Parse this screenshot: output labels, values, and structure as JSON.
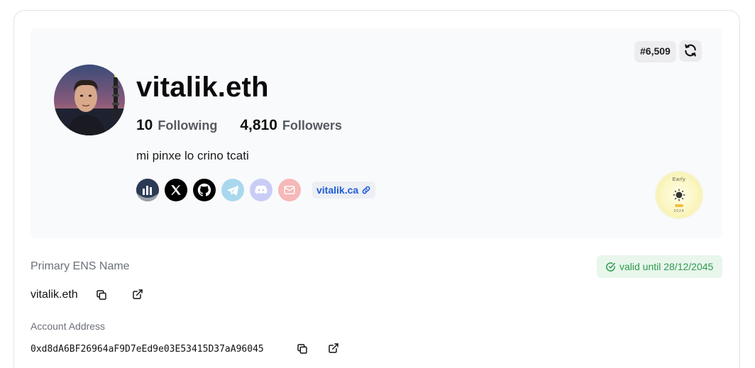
{
  "profile": {
    "name": "vitalik.eth",
    "rank": "#6,509",
    "following_count": "10",
    "following_label": "Following",
    "followers_count": "4,810",
    "followers_label": "Followers",
    "bio": "mi pinxe lo crino tcati",
    "website": "vitalik.ca",
    "socials": [
      "stats-icon",
      "x-icon",
      "github-icon",
      "telegram-icon",
      "discord-icon",
      "email-icon"
    ]
  },
  "badge": {
    "label": "Early",
    "year": "2024"
  },
  "ens": {
    "label": "Primary ENS Name",
    "value": "vitalik.eth",
    "valid_text": "valid until 28/12/2045"
  },
  "account": {
    "label": "Account Address",
    "address": "0xd8dA6BF26964aF9D7eEd9e03E53415D37aA96045"
  },
  "colors": {
    "valid_green": "#2e9a4f",
    "link_blue": "#1f5bd6"
  }
}
